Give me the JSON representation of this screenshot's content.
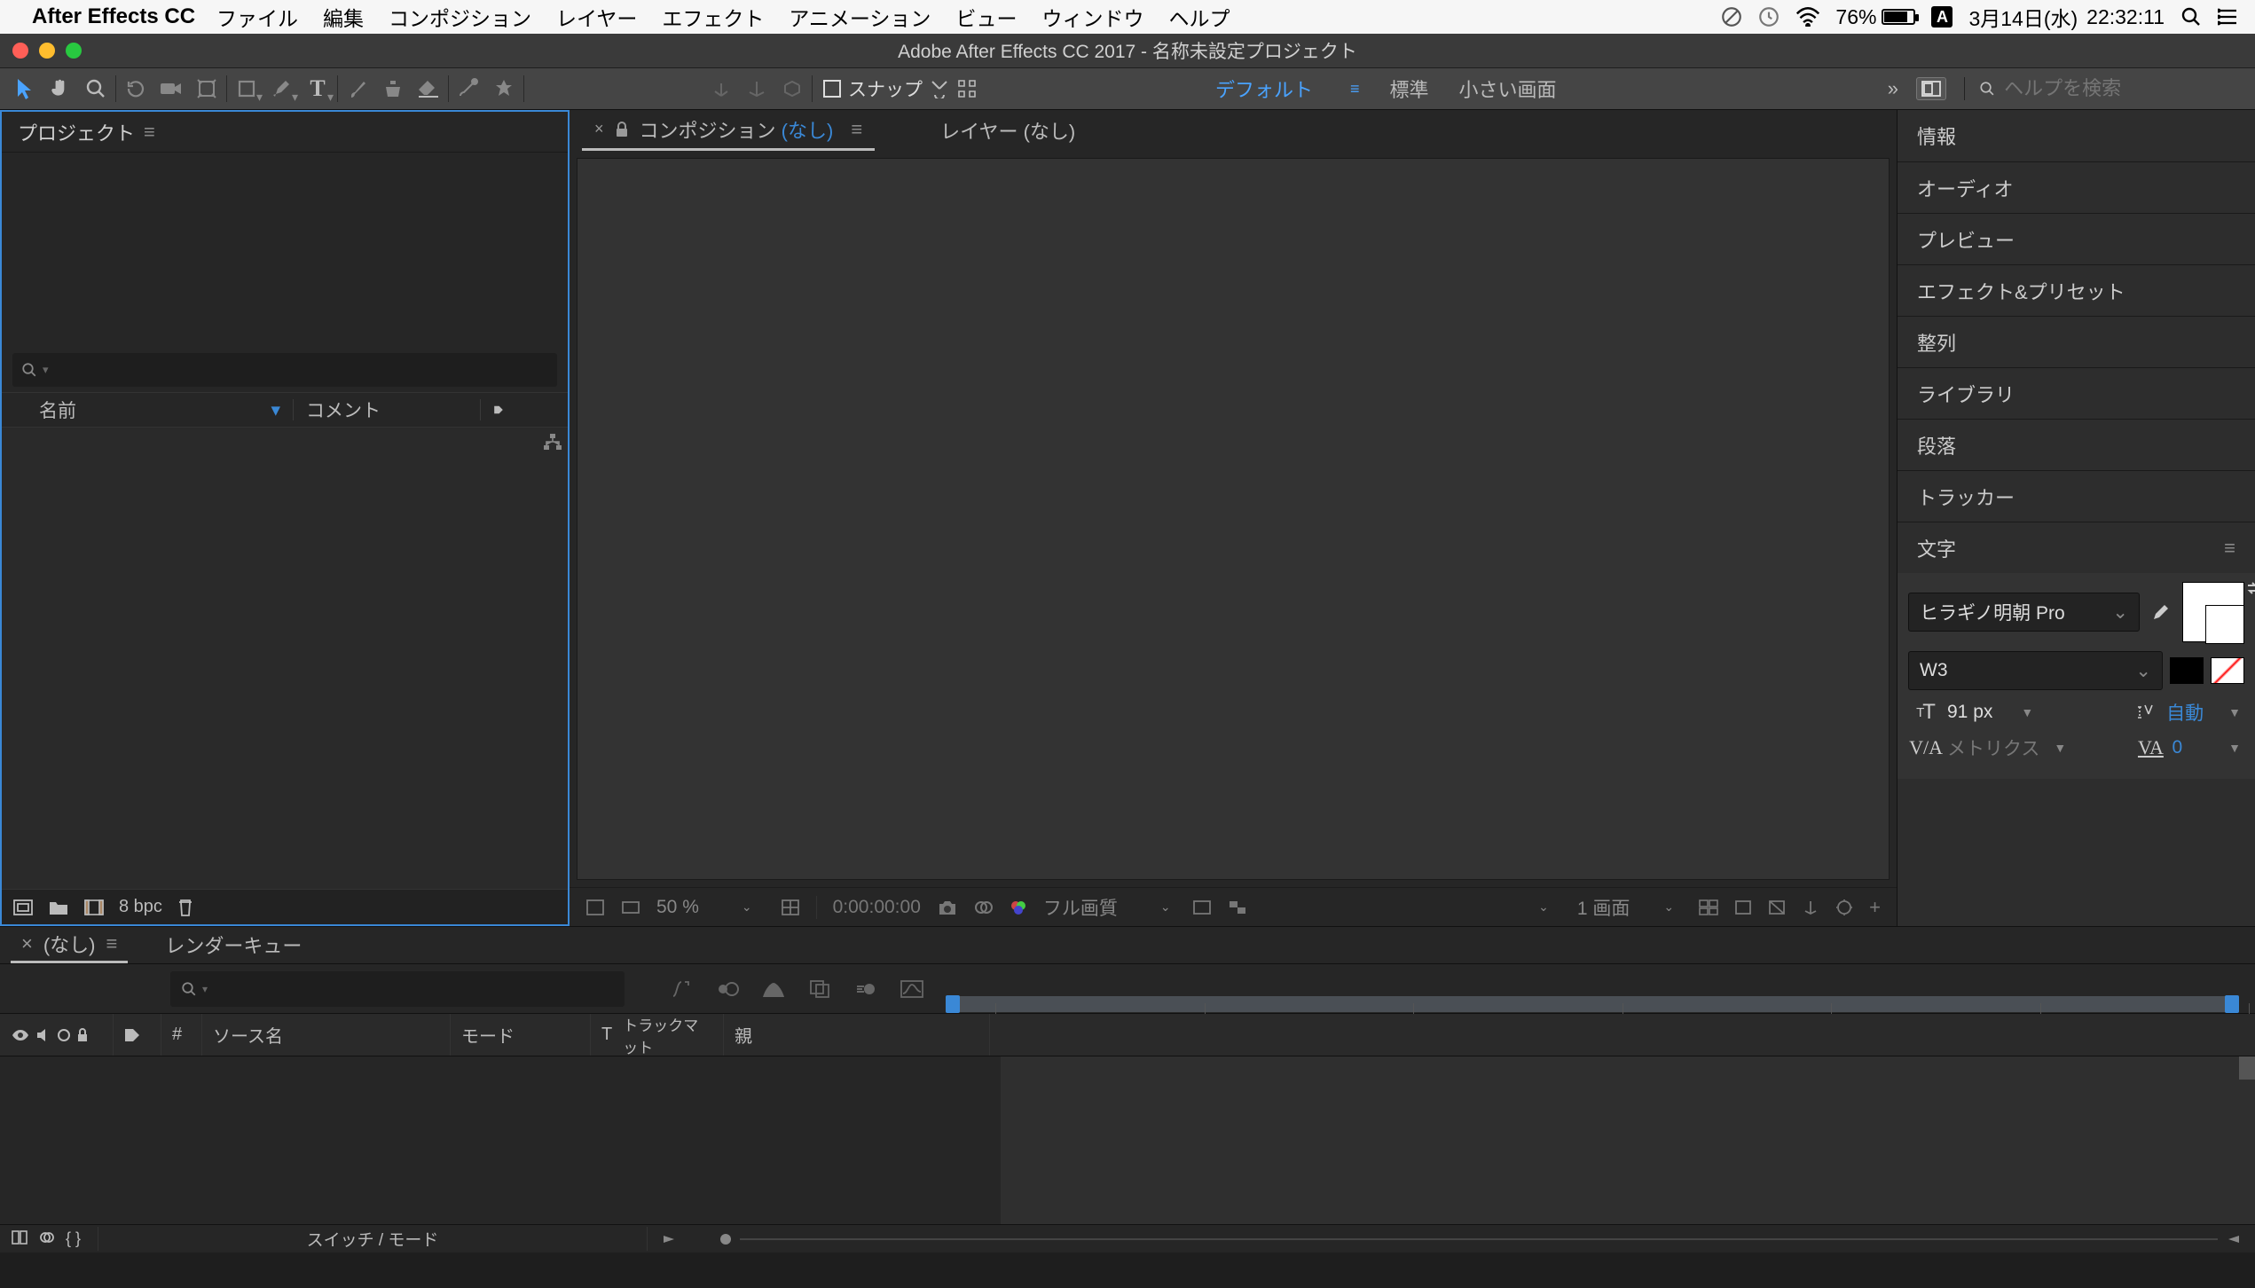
{
  "mac_menu": {
    "app_name": "After Effects CC",
    "items": [
      "ファイル",
      "編集",
      "コンポジション",
      "レイヤー",
      "エフェクト",
      "アニメーション",
      "ビュー",
      "ウィンドウ",
      "ヘルプ"
    ],
    "battery_pct": "76%",
    "date": "3月14日(水)",
    "time": "22:32:11"
  },
  "window": {
    "title": "Adobe After Effects CC 2017 - 名称未設定プロジェクト"
  },
  "toolbar": {
    "snap_label": "スナップ",
    "workspaces": {
      "default": "デフォルト",
      "standard": "標準",
      "small": "小さい画面"
    },
    "search_placeholder": "ヘルプを検索"
  },
  "project_panel": {
    "tab": "プロジェクト",
    "col_name": "名前",
    "col_comment": "コメント",
    "bpc": "8 bpc"
  },
  "comp_panel": {
    "tab_prefix": "コンポジション",
    "tab_none": "(なし)",
    "layer_tab": "レイヤー (なし)",
    "zoom": "50 %",
    "time": "0:00:00:00",
    "quality": "フル画質",
    "views": "1 画面"
  },
  "right_panels": {
    "info": "情報",
    "audio": "オーディオ",
    "preview": "プレビュー",
    "fxpreset": "エフェクト&プリセット",
    "align": "整列",
    "library": "ライブラリ",
    "para": "段落",
    "tracker": "トラッカー",
    "char": "文字"
  },
  "char_panel": {
    "font": "ヒラギノ明朝 Pro",
    "weight": "W3",
    "size": "91 px",
    "leading": "自動",
    "kerning": "メトリクス",
    "tracking": "0"
  },
  "timeline": {
    "tab_none": "(なし)",
    "render_queue": "レンダーキュー",
    "cols": {
      "source": "ソース名",
      "mode": "モード",
      "trkmat_t": "T",
      "trkmat": "トラックマット",
      "parent": "親",
      "hash": "#"
    },
    "switch_mode": "スイッチ / モード"
  }
}
